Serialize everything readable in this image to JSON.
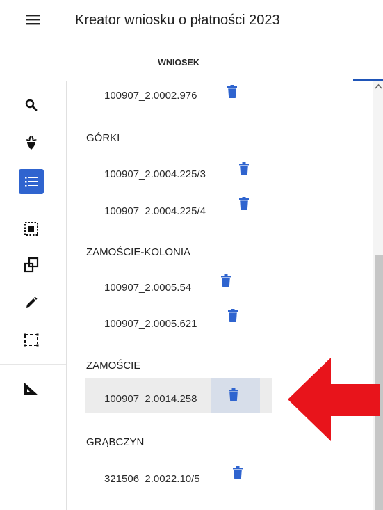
{
  "header": {
    "title": "Kreator wniosku o płatności 2023",
    "menu_icon": "hamburger-menu-icon"
  },
  "tabs": [
    {
      "label": "WNIOSEK",
      "active": true
    }
  ],
  "sidebar": {
    "items": [
      {
        "icon": "search-icon"
      },
      {
        "icon": "beet-icon"
      },
      {
        "icon": "list-icon",
        "active": true
      },
      {
        "icon": "select-area-icon"
      },
      {
        "icon": "copy-shapes-icon"
      },
      {
        "icon": "pencil-icon"
      },
      {
        "icon": "selection-frame-icon"
      },
      {
        "icon": "measure-ruler-icon"
      }
    ],
    "accent_color": "#2f64cf"
  },
  "list": {
    "top_parcel": {
      "id": "100907_2.0002.976"
    },
    "groups": [
      {
        "name": "GÓRKI",
        "parcels": [
          {
            "id": "100907_2.0004.225/3"
          },
          {
            "id": "100907_2.0004.225/4"
          }
        ]
      },
      {
        "name": "ZAMOŚCIE-KOLONIA",
        "parcels": [
          {
            "id": "100907_2.0005.54"
          },
          {
            "id": "100907_2.0005.621"
          }
        ]
      },
      {
        "name": "ZAMOŚCIE",
        "parcels": [
          {
            "id": "100907_2.0014.258",
            "highlighted": true
          }
        ]
      },
      {
        "name": "GRĄBCZYN",
        "parcels": [
          {
            "id": "321506_2.0022.10/5"
          }
        ]
      }
    ],
    "delete_icon": "trash-icon",
    "delete_icon_color": "#2f64cf"
  },
  "annotation": {
    "arrow_color": "#e8141b",
    "arrow_icon": "red-arrow-left"
  }
}
